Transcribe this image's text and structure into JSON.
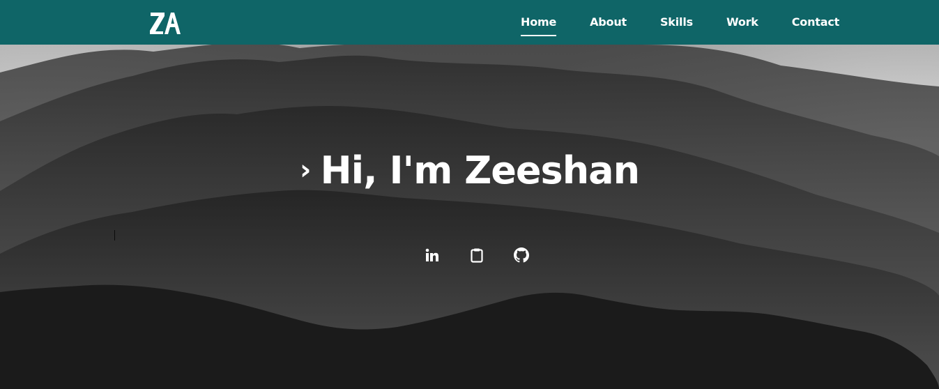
{
  "header": {
    "background": "#0f6567",
    "logo_icon": "za-monogram-logo-icon",
    "nav": [
      {
        "label": "Home",
        "active": true
      },
      {
        "label": "About",
        "active": false
      },
      {
        "label": "Skills",
        "active": false
      },
      {
        "label": "Work",
        "active": false
      },
      {
        "label": "Contact",
        "active": false
      }
    ]
  },
  "hero": {
    "prompt_symbol": "›",
    "title": "Hi, I'm Zeeshan",
    "socials": [
      {
        "icon": "linkedin-icon"
      },
      {
        "icon": "clipboard-icon"
      },
      {
        "icon": "github-icon"
      }
    ]
  },
  "colors": {
    "accent": "#0f6567",
    "text": "#ffffff",
    "dark": "#1a1a1a"
  }
}
